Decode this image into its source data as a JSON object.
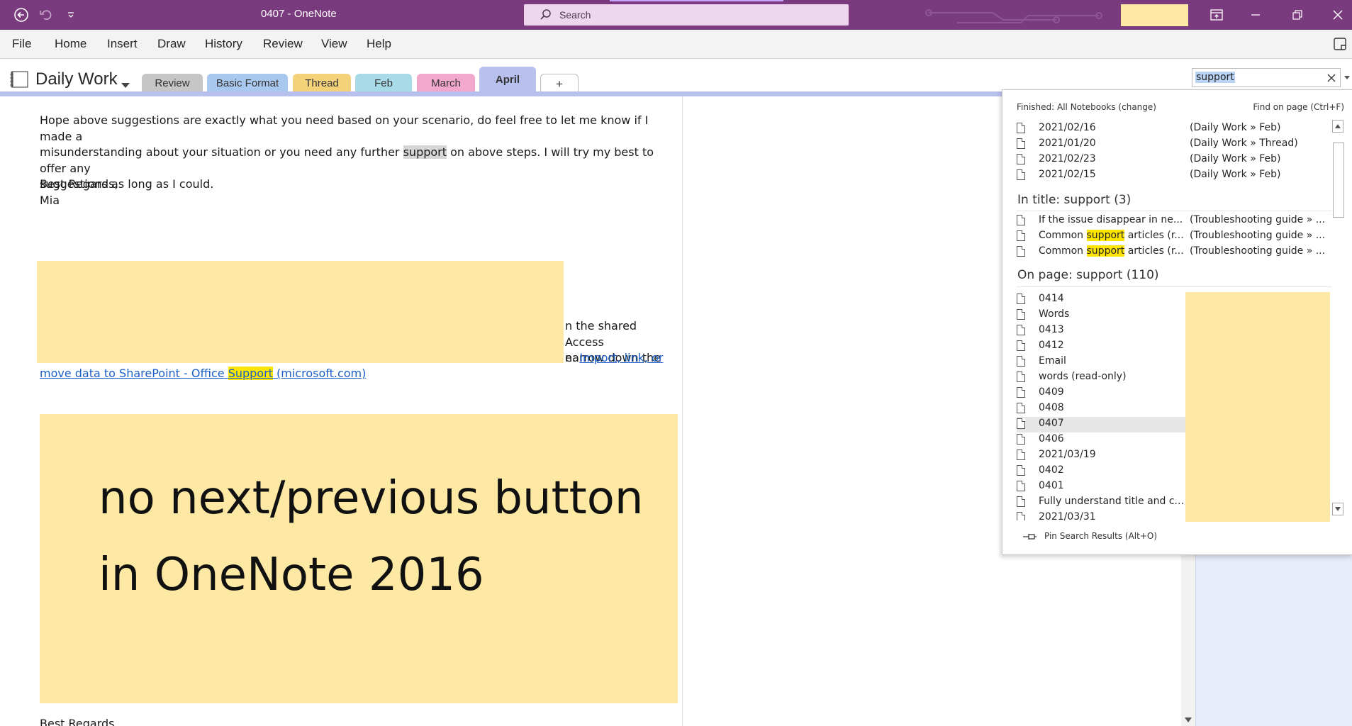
{
  "titlebar": {
    "title": "0407  -  OneNote",
    "search_label": "Search",
    "accent_color": "#7a3b7e"
  },
  "menu": {
    "items": [
      "File",
      "Home",
      "Insert",
      "Draw",
      "History",
      "Review",
      "View",
      "Help"
    ]
  },
  "notebook": {
    "name": "Daily Work",
    "tabs": [
      {
        "label": "Review",
        "color": "#c6c6c6"
      },
      {
        "label": "Basic Format",
        "color": "#a9c8ef"
      },
      {
        "label": "Thread",
        "color": "#f4d27a"
      },
      {
        "label": "Feb",
        "color": "#a7dbe8"
      },
      {
        "label": "March",
        "color": "#f2a8cc"
      },
      {
        "label": "April",
        "color": "#b8c0ee"
      },
      {
        "label": "+",
        "color": "#ffffff"
      }
    ]
  },
  "page": {
    "para1_a": "Hope above suggestions are exactly what you need based on your scenario, do feel free to let me know if I made a",
    "para1_b1": "misunderstanding about your situation or you need any further ",
    "para1_hl": "support",
    "para1_b2": " on above steps. I will try my best to offer any",
    "para1_c": "suggestions as long as I could.",
    "regards": "Best Regards,",
    "name": "Mia",
    "frag1": "n the shared Access",
    "frag2": "narrow down the",
    "frag3": "e: ",
    "link_a": "Import, link, or",
    "link_b1": "move data to SharePoint - Office ",
    "link_hl": "Support",
    "link_b2": " (microsoft.com)",
    "big_line1": "no next/previous button",
    "big_line2": "in OneNote 2016",
    "regards2": "Best Regards"
  },
  "find": {
    "query": "support",
    "status": "Finished:  All Notebooks (change)",
    "find_on_page": "Find on page (Ctrl+F)",
    "recent": [
      {
        "name": "2021/02/16",
        "section": "(Daily Work » Feb)"
      },
      {
        "name": "2021/01/20",
        "section": "(Daily Work » Thread)"
      },
      {
        "name": "2021/02/23",
        "section": "(Daily Work » Feb)"
      },
      {
        "name": "2021/02/15",
        "section": "(Daily Work » Feb)"
      }
    ],
    "in_title_label": "In title:  support (3)",
    "in_title": [
      {
        "name_a": "If the issue disappear in ne...",
        "name_hl": "",
        "name_b": "",
        "section": "(Troubleshooting guide » ..."
      },
      {
        "name_a": "Common ",
        "name_hl": "support",
        "name_b": " articles (r...",
        "section": "(Troubleshooting guide » ..."
      },
      {
        "name_a": "Common ",
        "name_hl": "support",
        "name_b": " articles (r...",
        "section": "(Troubleshooting guide » ..."
      }
    ],
    "on_page_label": "On page:  support (110)",
    "on_page": [
      "0414",
      "Words",
      "0413",
      "0412",
      "Email",
      "words (read-only)",
      "0409",
      "0408",
      "0407",
      "0406",
      "2021/03/19",
      "0402",
      "0401",
      "Fully understand title and c...",
      "2021/03/31"
    ],
    "pin_label": "Pin Search Results (Alt+O)"
  }
}
